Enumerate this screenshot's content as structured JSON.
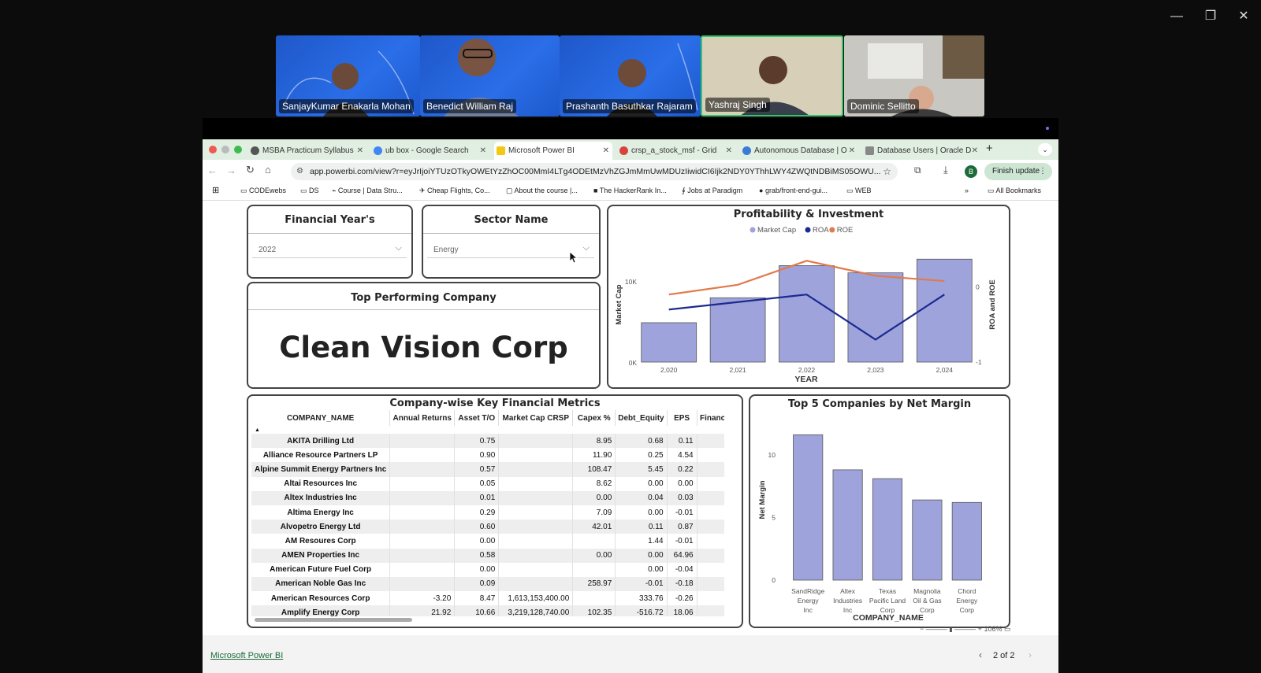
{
  "window": {
    "minimize": "—",
    "restore": "❐",
    "close": "✕"
  },
  "participants": [
    {
      "name": "SanjayKumar Enakarla Mohan"
    },
    {
      "name": "Benedict William Raj"
    },
    {
      "name": "Prashanth Basuthkar Rajaram"
    },
    {
      "name": "Yashraj Singh"
    },
    {
      "name": "Dominic Sellitto"
    }
  ],
  "tabs": [
    {
      "label": "MSBA Practicum Syllabus",
      "color": "#555"
    },
    {
      "label": "ub box - Google Search",
      "color": "#4285f4"
    },
    {
      "label": "Microsoft Power BI",
      "color": "#f2c811"
    },
    {
      "label": "crsp_a_stock_msf - Grid",
      "color": "#d6453d"
    },
    {
      "label": "Autonomous Database | O",
      "color": "#3a7bd5"
    },
    {
      "label": "Database Users | Oracle D",
      "color": "#888"
    }
  ],
  "url": "app.powerbi.com/view?r=eyJrIjoiYTUzOTkyOWEtYzZhOC00MmI4LTg4ODEtMzVhZGJmMmUwMDUzIiwidCI6Ijk2NDY0YThhLWY4ZWQtNDBiMS05OWU...",
  "finish_update": "Finish update",
  "profile_initial": "B",
  "bookmarks": [
    "CODEwebs",
    "DS",
    "Course | Data Stru...",
    "Cheap Flights, Co...",
    "About the course |...",
    "The HackerRank In...",
    "Jobs at Paradigm",
    "grab/front-end-gui...",
    "WEB"
  ],
  "all_bookmarks": "All Bookmarks",
  "slicers": {
    "year": {
      "title": "Financial Year's",
      "value": "2022"
    },
    "sector": {
      "title": "Sector Name",
      "value": "Energy"
    }
  },
  "top_company": {
    "title": "Top Performing Company",
    "value": "Clean Vision Corp"
  },
  "combo": {
    "title": "Profitability & Investment",
    "legend": [
      {
        "name": "Market Cap",
        "color": "#9fa3db"
      },
      {
        "name": "ROA",
        "color": "#1b2a8f"
      },
      {
        "name": "ROE",
        "color": "#e07b4d"
      }
    ],
    "xlabel": "YEAR",
    "ylabel_left": "Market Cap",
    "ylabel_right": "ROA and ROE",
    "left_ticks": [
      "0K",
      "10K"
    ],
    "right_ticks": [
      "-1",
      "0"
    ]
  },
  "chart_data": [
    {
      "type": "bar",
      "title": "Profitability & Investment",
      "categories": [
        "2,020",
        "2,021",
        "2,022",
        "2,023",
        "2,024"
      ],
      "series": [
        {
          "name": "Market Cap",
          "values": [
            4900,
            8000,
            12000,
            11100,
            12800
          ]
        },
        {
          "name": "ROA",
          "values": [
            -0.3,
            -0.2,
            -0.1,
            -0.7,
            -0.1
          ]
        },
        {
          "name": "ROE",
          "values": [
            -0.1,
            0.03,
            0.35,
            0.15,
            0.08
          ]
        }
      ],
      "xlabel": "YEAR",
      "ylabel": "Market Cap",
      "ylim": [
        0,
        14000
      ],
      "y2lim": [
        -1,
        0.5
      ]
    },
    {
      "type": "bar",
      "title": "Top 5 Companies by Net Margin",
      "categories": [
        "SandRidge Energy Inc",
        "Altex Industries Inc",
        "Texas Pacific Land Corp",
        "Magnolia Oil & Gas Corp",
        "Chord Energy Corp"
      ],
      "values": [
        11.6,
        8.8,
        8.1,
        6.4,
        6.2
      ],
      "xlabel": "COMPANY_NAME",
      "ylabel": "Net Margin",
      "ylim": [
        0,
        12.5
      ],
      "ticks": [
        "0",
        "5",
        "10"
      ]
    },
    {
      "type": "table",
      "title": "Company-wise Key Financial Metrics",
      "columns": [
        "COMPANY_NAME",
        "Annual Returns",
        "Asset T/O",
        "Market Cap CRSP",
        "Capex %",
        "Debt_Equity",
        "EPS",
        "Financ"
      ],
      "rows": [
        [
          "AKITA Drilling Ltd",
          "",
          "0.75",
          "",
          "8.95",
          "0.68",
          "0.11",
          ""
        ],
        [
          "Alliance Resource Partners LP",
          "",
          "0.90",
          "",
          "11.90",
          "0.25",
          "4.54",
          ""
        ],
        [
          "Alpine Summit Energy Partners Inc",
          "",
          "0.57",
          "",
          "108.47",
          "5.45",
          "0.22",
          ""
        ],
        [
          "Altai Resources Inc",
          "",
          "0.05",
          "",
          "8.62",
          "0.00",
          "0.00",
          ""
        ],
        [
          "Altex Industries Inc",
          "",
          "0.01",
          "",
          "0.00",
          "0.04",
          "0.03",
          ""
        ],
        [
          "Altima Energy Inc",
          "",
          "0.29",
          "",
          "7.09",
          "0.00",
          "-0.01",
          ""
        ],
        [
          "Alvopetro Energy Ltd",
          "",
          "0.60",
          "",
          "42.01",
          "0.11",
          "0.87",
          ""
        ],
        [
          "AM Resoures Corp",
          "",
          "0.00",
          "",
          "",
          "1.44",
          "-0.01",
          ""
        ],
        [
          "AMEN Properties Inc",
          "",
          "0.58",
          "",
          "0.00",
          "0.00",
          "64.96",
          ""
        ],
        [
          "American Future Fuel Corp",
          "",
          "0.00",
          "",
          "",
          "0.00",
          "-0.04",
          ""
        ],
        [
          "American Noble Gas Inc",
          "",
          "0.09",
          "",
          "258.97",
          "-0.01",
          "-0.18",
          ""
        ],
        [
          "American Resources Corp",
          "-3.20",
          "8.47",
          "1,613,153,400.00",
          "",
          "333.76",
          "-0.26",
          ""
        ],
        [
          "Amplify Energy Corp",
          "21.92",
          "10.66",
          "3,219,128,740.00",
          "102.35",
          "-516.72",
          "18.06",
          ""
        ]
      ]
    }
  ],
  "footer": {
    "brand": "Microsoft Power BI",
    "page": "2 of 2",
    "zoom": "106%"
  }
}
